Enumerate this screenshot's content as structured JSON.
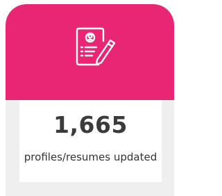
{
  "card": {
    "icon": "resume-edit-icon",
    "value": "1,665",
    "label": "profiles/resumes updated",
    "colors": {
      "accent": "#e82674",
      "background": "#efefef",
      "panel": "#ffffff",
      "text": "#3b3b3b"
    }
  }
}
